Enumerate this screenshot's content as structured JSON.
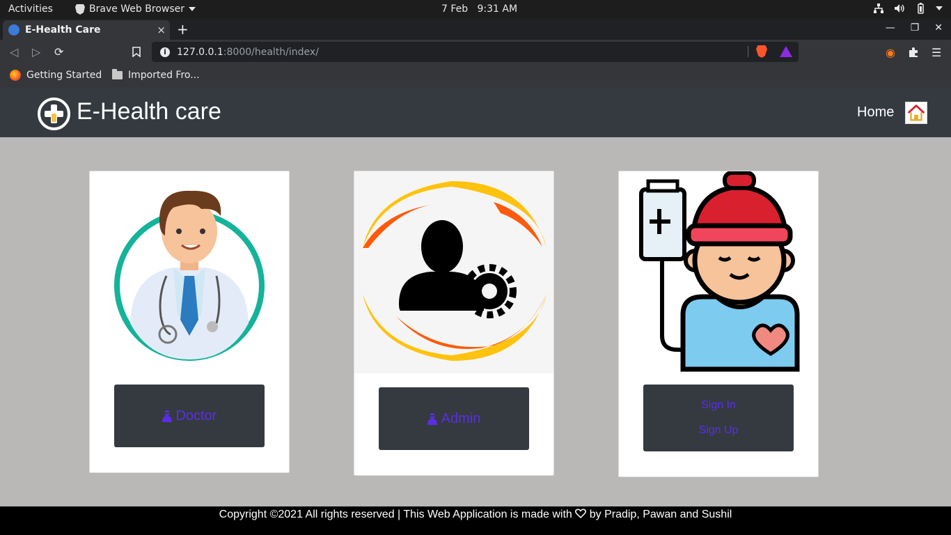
{
  "system": {
    "activities": "Activities",
    "app_name": "Brave Web Browser",
    "clock_date": "7 Feb",
    "clock_time": "9:31 AM"
  },
  "browser": {
    "tab_title": "E-Health Care",
    "tab_close": "×",
    "new_tab": "+",
    "url_host": "127.0.0.1",
    "url_path": ":8000/health/index/",
    "bookmarks": [
      {
        "label": "Getting Started",
        "icon": "firefox-icon"
      },
      {
        "label": "Imported Fro...",
        "icon": "folder-icon"
      }
    ]
  },
  "site": {
    "brand": "E-Health care",
    "nav_home": "Home",
    "cards": {
      "doctor": {
        "button_label": "Doctor",
        "icon": "user-secret-icon"
      },
      "admin": {
        "button_label": "Admin",
        "icon": "user-secret-icon"
      },
      "patient": {
        "sign_in": "Sign In",
        "sign_up": "Sign Up"
      }
    },
    "footer_before": "Copyright ©2021 All rights reserved | This Web Application is made with",
    "footer_after": "by Pradip, Pawan and Sushil"
  },
  "colors": {
    "header_bg": "#343a40",
    "page_bg": "#b9b8b6",
    "button_text": "#5a2ee6",
    "doctor_ring": "#14b39a",
    "admin_orange": "#ff5a0a",
    "admin_yellow": "#ffc20e",
    "patient_hat": "#d9202e"
  }
}
